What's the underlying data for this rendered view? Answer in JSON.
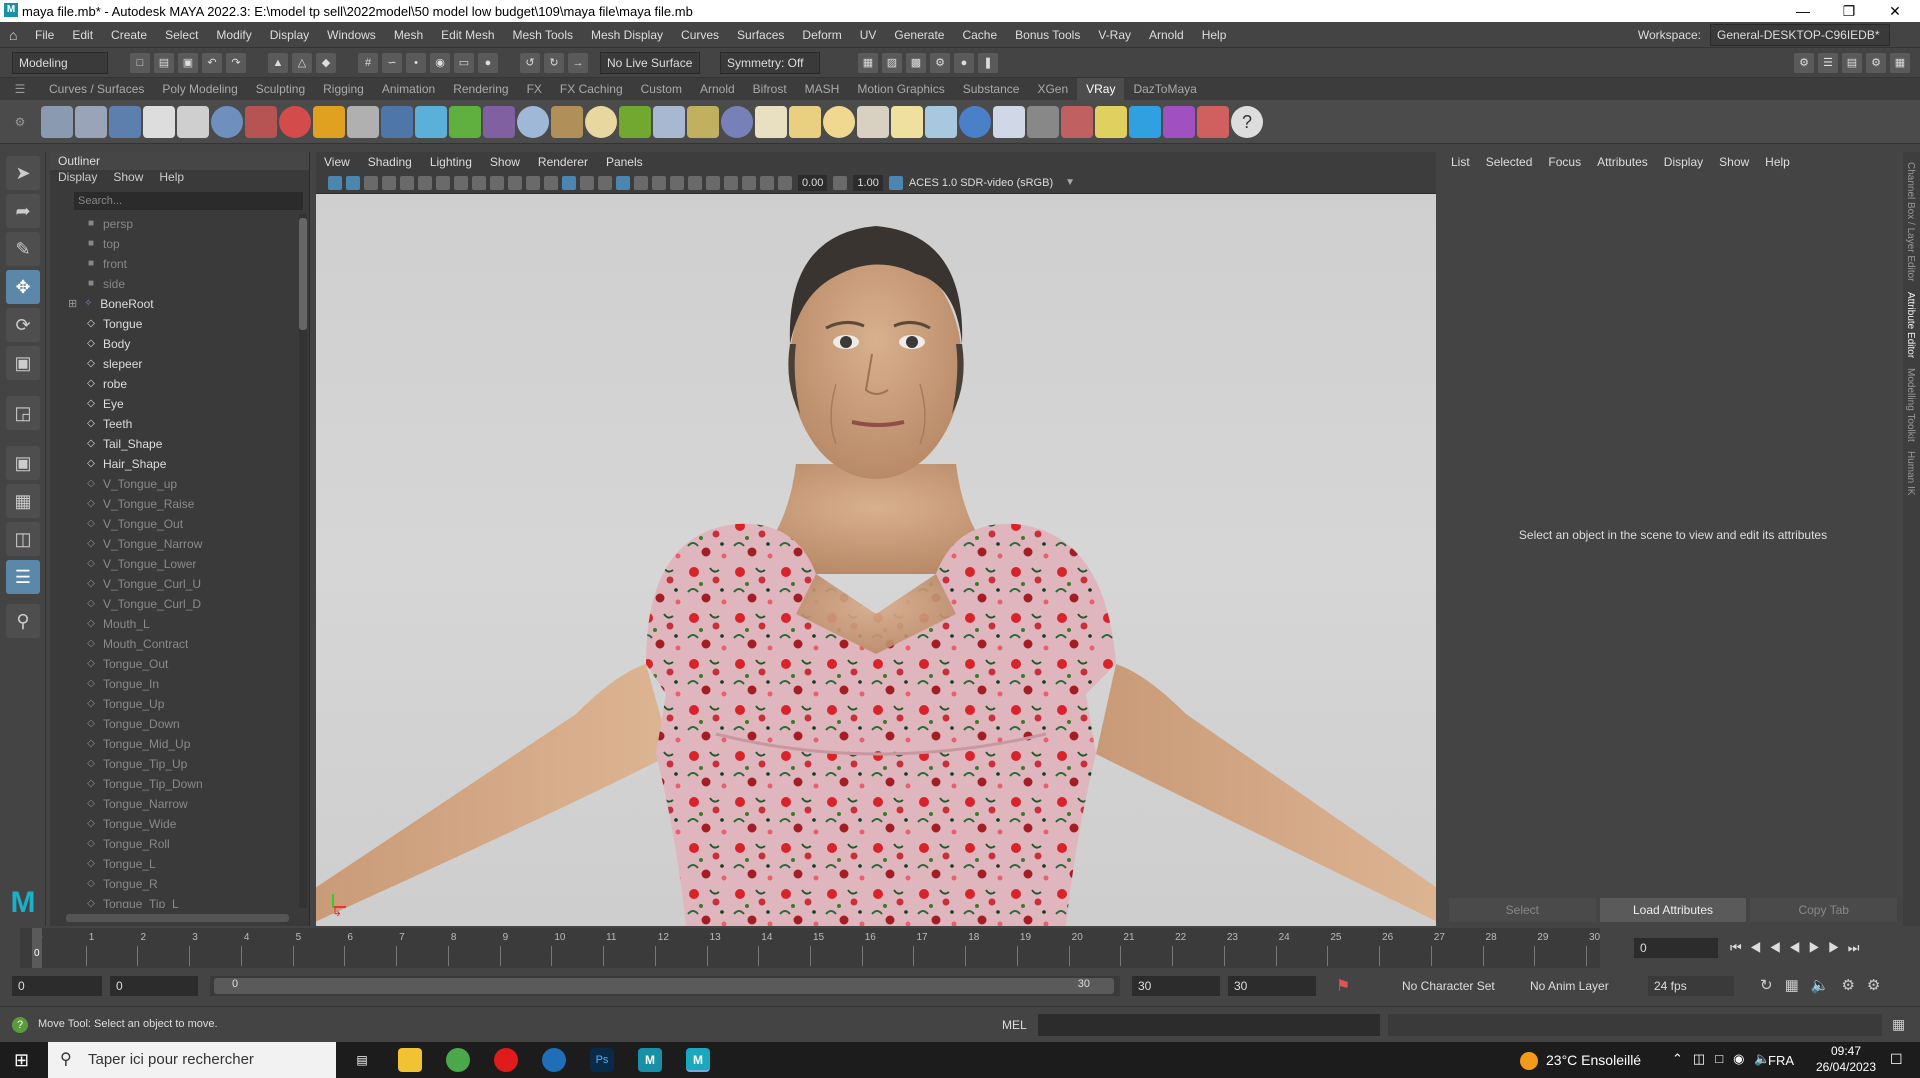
{
  "titlebar": {
    "title": "maya file.mb* - Autodesk MAYA 2022.3: E:\\model tp sell\\2022model\\50 model low budget\\109\\maya file\\maya file.mb",
    "logo": "M"
  },
  "menubar": {
    "items": [
      "File",
      "Edit",
      "Create",
      "Select",
      "Modify",
      "Display",
      "Windows",
      "Mesh",
      "Edit Mesh",
      "Mesh Tools",
      "Mesh Display",
      "Curves",
      "Surfaces",
      "Deform",
      "UV",
      "Generate",
      "Cache",
      "Bonus Tools",
      "V-Ray",
      "Arnold",
      "Help"
    ],
    "workspace_label": "Workspace:",
    "workspace_value": "General-DESKTOP-C96IEDB*"
  },
  "statusline": {
    "mode": "Modeling",
    "live_surface": "No Live Surface",
    "symmetry": "Symmetry: Off"
  },
  "shelf": {
    "tabs": [
      "Curves / Surfaces",
      "Poly Modeling",
      "Sculpting",
      "Rigging",
      "Animation",
      "Rendering",
      "FX",
      "FX Caching",
      "Custom",
      "Arnold",
      "Bifrost",
      "MASH",
      "Motion Graphics",
      "Substance",
      "XGen",
      "VRay",
      "DazToMaya"
    ],
    "active_tab": "VRay"
  },
  "outliner": {
    "title": "Outliner",
    "menu": [
      "Display",
      "Show",
      "Help"
    ],
    "search_placeholder": "Search...",
    "items": [
      {
        "label": "persp",
        "kind": "cam"
      },
      {
        "label": "top",
        "kind": "cam"
      },
      {
        "label": "front",
        "kind": "cam"
      },
      {
        "label": "side",
        "kind": "cam"
      },
      {
        "label": "BoneRoot",
        "kind": "jnt"
      },
      {
        "label": "Tongue",
        "kind": "mesh"
      },
      {
        "label": "Body",
        "kind": "mesh"
      },
      {
        "label": "slepeer",
        "kind": "mesh"
      },
      {
        "label": "robe",
        "kind": "mesh"
      },
      {
        "label": "Eye",
        "kind": "mesh"
      },
      {
        "label": "Teeth",
        "kind": "mesh"
      },
      {
        "label": "Tail_Shape",
        "kind": "mesh"
      },
      {
        "label": "Hair_Shape",
        "kind": "mesh"
      },
      {
        "label": "V_Tongue_up",
        "kind": "dim"
      },
      {
        "label": "V_Tongue_Raise",
        "kind": "dim"
      },
      {
        "label": "V_Tongue_Out",
        "kind": "dim"
      },
      {
        "label": "V_Tongue_Narrow",
        "kind": "dim"
      },
      {
        "label": "V_Tongue_Lower",
        "kind": "dim"
      },
      {
        "label": "V_Tongue_Curl_U",
        "kind": "dim"
      },
      {
        "label": "V_Tongue_Curl_D",
        "kind": "dim"
      },
      {
        "label": "Mouth_L",
        "kind": "dim"
      },
      {
        "label": "Mouth_Contract",
        "kind": "dim"
      },
      {
        "label": "Tongue_Out",
        "kind": "dim"
      },
      {
        "label": "Tongue_In",
        "kind": "dim"
      },
      {
        "label": "Tongue_Up",
        "kind": "dim"
      },
      {
        "label": "Tongue_Down",
        "kind": "dim"
      },
      {
        "label": "Tongue_Mid_Up",
        "kind": "dim"
      },
      {
        "label": "Tongue_Tip_Up",
        "kind": "dim"
      },
      {
        "label": "Tongue_Tip_Down",
        "kind": "dim"
      },
      {
        "label": "Tongue_Narrow",
        "kind": "dim"
      },
      {
        "label": "Tongue_Wide",
        "kind": "dim"
      },
      {
        "label": "Tongue_Roll",
        "kind": "dim"
      },
      {
        "label": "Tongue_L",
        "kind": "dim"
      },
      {
        "label": "Tongue_R",
        "kind": "dim"
      },
      {
        "label": "Tongue_Tip_L",
        "kind": "dim"
      }
    ]
  },
  "viewport": {
    "menu": [
      "View",
      "Shading",
      "Lighting",
      "Show",
      "Renderer",
      "Panels"
    ],
    "exposure": "0.00",
    "gamma": "1.00",
    "color_space": "ACES 1.0 SDR-video (sRGB)"
  },
  "attribute_editor": {
    "menu": [
      "List",
      "Selected",
      "Focus",
      "Attributes",
      "Display",
      "Show",
      "Help"
    ],
    "message": "Select an object in the scene to view and edit its attributes",
    "buttons": [
      "Select",
      "Load Attributes",
      "Copy Tab"
    ],
    "side_tabs": [
      "Channel Box / Layer Editor",
      "Attribute Editor",
      "Modelling Toolkit",
      "Human IK"
    ]
  },
  "timeslider": {
    "ticks": [
      "0",
      "1",
      "2",
      "3",
      "4",
      "5",
      "6",
      "7",
      "8",
      "9",
      "10",
      "11",
      "12",
      "13",
      "14",
      "15",
      "16",
      "17",
      "18",
      "19",
      "20",
      "21",
      "22",
      "23",
      "24",
      "25",
      "26",
      "27",
      "28",
      "29",
      "30"
    ],
    "current_frame": "0"
  },
  "range": {
    "start": "0",
    "anim_start": "0",
    "slider_start": "0",
    "slider_end": "30",
    "anim_end": "30",
    "end": "30",
    "character_set": "No Character Set",
    "anim_layer": "No Anim Layer",
    "fps": "24 fps"
  },
  "helpline": {
    "text": "Move Tool: Select an object to move.",
    "mel": "MEL"
  },
  "taskbar": {
    "search": "Taper ici pour rechercher",
    "weather": "23°C  Ensoleillé",
    "lang": "FRA",
    "time": "09:47",
    "date": "26/04/2023"
  }
}
